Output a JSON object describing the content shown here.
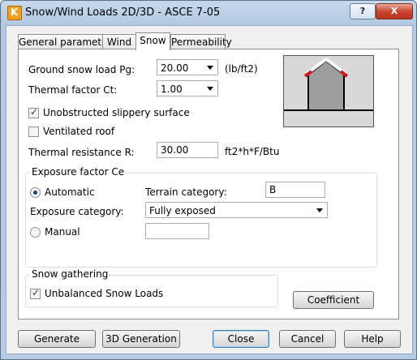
{
  "window": {
    "title": "Snow/Wind Loads 2D/3D - ASCE 7-05",
    "app_icon": "K",
    "help_button": "?",
    "close_button": "X",
    "colors": {
      "title_gradient_top": "#c6d8ec",
      "client_bg": "#f0f0f0",
      "accent": "#3c7fb1",
      "close_red": "#c8462f"
    }
  },
  "tabs": [
    {
      "label": "General parameters",
      "active": false
    },
    {
      "label": "Wind",
      "active": false
    },
    {
      "label": "Snow",
      "active": true
    },
    {
      "label": "Permeability",
      "active": false
    }
  ],
  "snow": {
    "ground_snow_load": {
      "label": "Ground snow load Pg:",
      "value": "20.00",
      "unit": "(lb/ft2)"
    },
    "thermal_factor": {
      "label": "Thermal factor Ct:",
      "value": "1.00"
    },
    "unobstructed": {
      "label": "Unobstructed slippery surface",
      "checked": true
    },
    "ventilated": {
      "label": "Ventilated roof",
      "checked": false
    },
    "thermal_resistance": {
      "label": "Thermal resistance R:",
      "value": "30.00",
      "unit": "ft2*h*F/Btu"
    },
    "exposure": {
      "group_title": "Exposure factor Ce",
      "automatic": {
        "label": "Automatic",
        "selected": true
      },
      "terrain_label": "Terrain category:",
      "terrain_value": "B",
      "category_label": "Exposure category:",
      "category_value": "Fully exposed",
      "manual": {
        "label": "Manual",
        "selected": false
      },
      "manual_value": ""
    },
    "gathering": {
      "group_title": "Snow gathering",
      "unbalanced": {
        "label": "Unbalanced Snow Loads",
        "checked": true
      }
    },
    "coefficient_button": "Coefficient"
  },
  "footer": {
    "generate": "Generate",
    "generation_3d": "3D Generation",
    "close": "Close",
    "cancel": "Cancel",
    "help": "Help"
  }
}
